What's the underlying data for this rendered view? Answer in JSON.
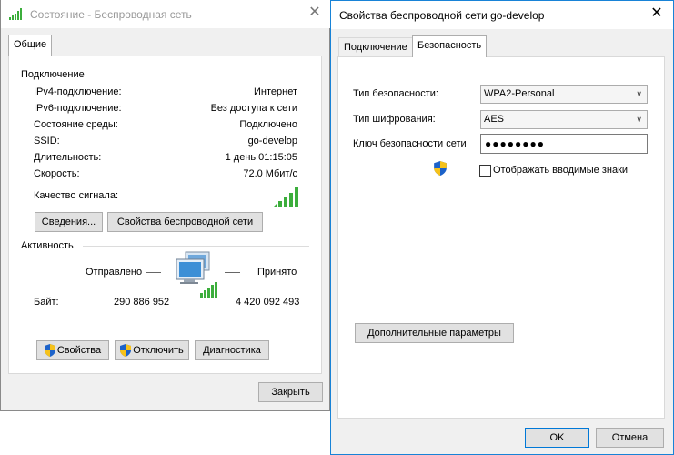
{
  "left_window": {
    "title": "Состояние - Беспроводная сеть",
    "close_glyph": "✕",
    "tab": "Общие",
    "connection": {
      "group_label": "Подключение",
      "rows": [
        {
          "label": "IPv4-подключение:",
          "value": "Интернет"
        },
        {
          "label": "IPv6-подключение:",
          "value": "Без доступа к сети"
        },
        {
          "label": "Состояние среды:",
          "value": "Подключено"
        },
        {
          "label": "SSID:",
          "value": "go-develop"
        },
        {
          "label": "Длительность:",
          "value": "1 день 01:15:05"
        },
        {
          "label": "Скорость:",
          "value": "72.0 Мбит/с"
        }
      ],
      "signal_label": "Качество сигнала:",
      "signal_bars": 5,
      "details_button": "Сведения...",
      "wireless_props_button": "Свойства беспроводной сети"
    },
    "activity": {
      "group_label": "Активность",
      "sent_label": "Отправлено",
      "received_label": "Принято",
      "bytes_label": "Байт:",
      "bytes_sent": "290 886 952",
      "bytes_received": "4 420 092 493"
    },
    "buttons": {
      "properties": "Свойства",
      "disable": "Отключить",
      "diagnose": "Диагностика",
      "close": "Закрыть"
    }
  },
  "right_window": {
    "title": "Свойства беспроводной сети go-develop",
    "close_glyph": "✕",
    "tabs": [
      "Подключение",
      "Безопасность"
    ],
    "active_tab": "Безопасность",
    "security_type_label": "Тип безопасности:",
    "security_type_value": "WPA2-Personal",
    "encryption_type_label": "Тип шифрования:",
    "encryption_type_value": "AES",
    "key_label": "Ключ безопасности сети",
    "key_value": "●●●●●●●●",
    "show_chars_label": "Отображать вводимые знаки",
    "show_chars_checked": false,
    "advanced_button": "Дополнительные параметры",
    "ok_button": "OK",
    "cancel_button": "Отмена"
  },
  "colors": {
    "signal_green": "#3cae3c",
    "accent_blue": "#0078d7",
    "title_inactive": "#999999"
  }
}
